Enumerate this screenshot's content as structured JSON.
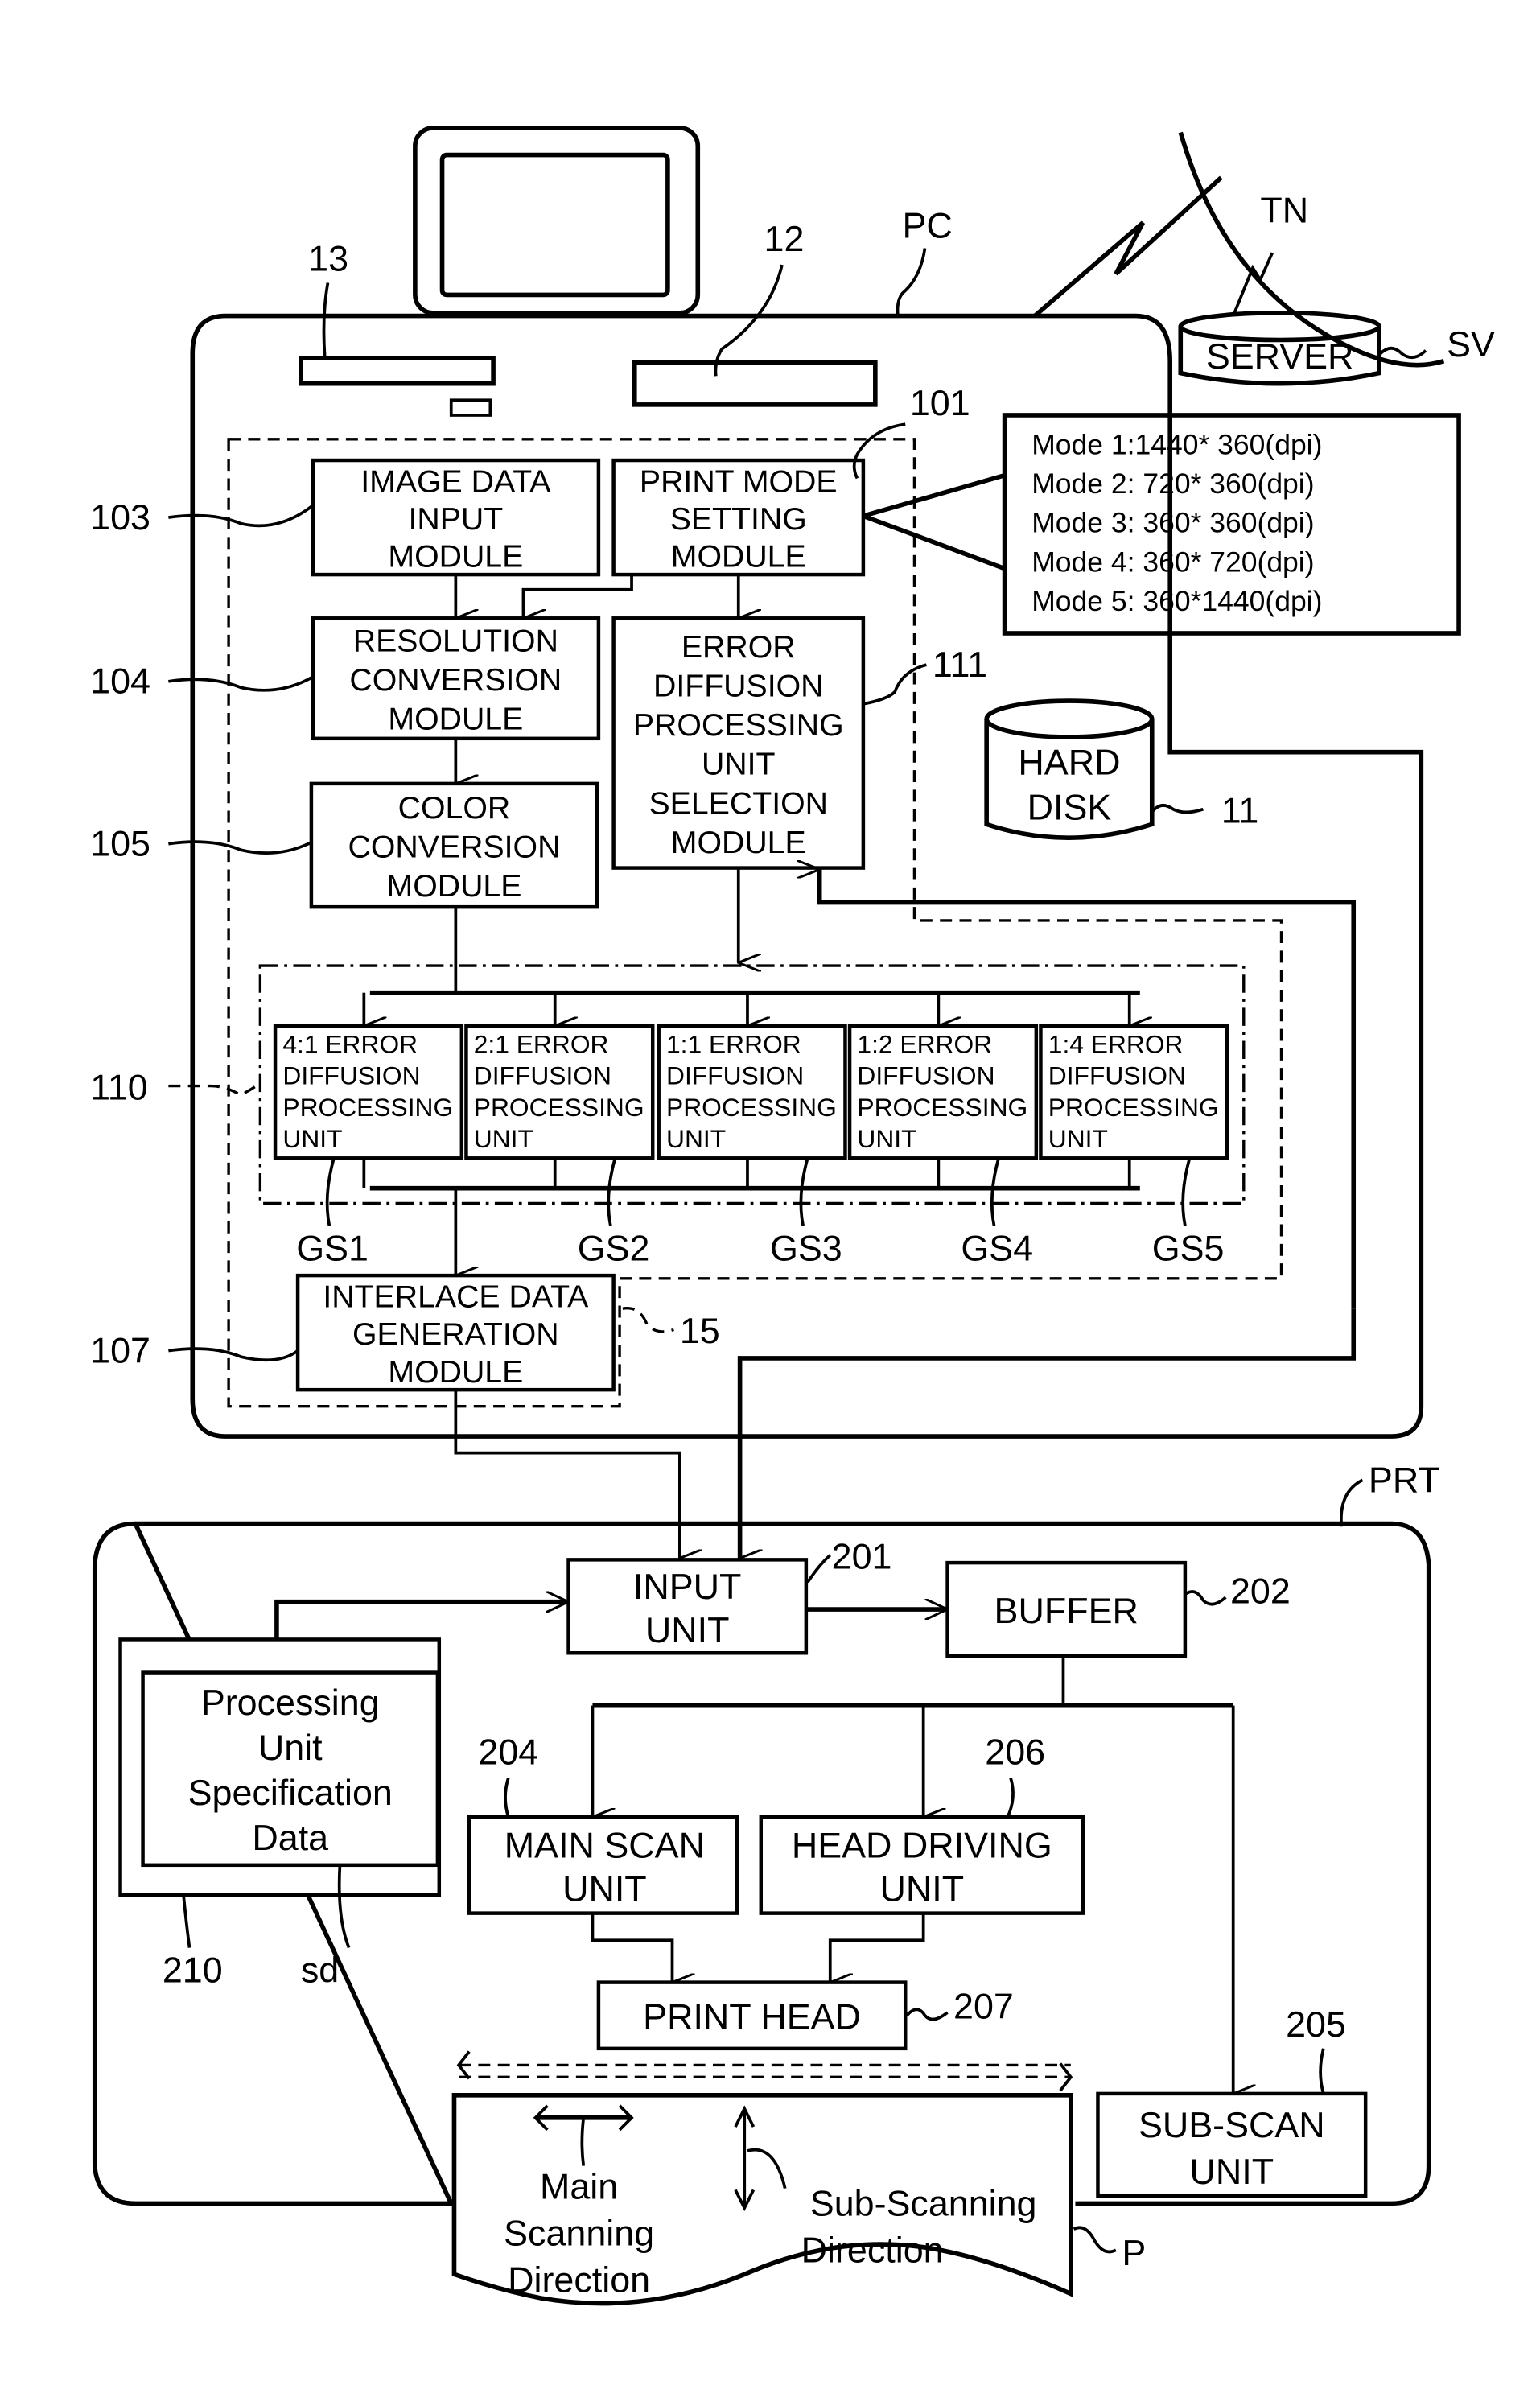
{
  "labels": {
    "pc": "PC",
    "tn": "TN",
    "sv": "SV",
    "ref_13": "13",
    "ref_12": "12",
    "ref_101": "101",
    "ref_103": "103",
    "ref_104": "104",
    "ref_105": "105",
    "ref_111": "111",
    "ref_11": "11",
    "ref_110": "110",
    "ref_107": "107",
    "ref_15": "15",
    "prt": "PRT",
    "ref_201": "201",
    "ref_202": "202",
    "ref_204": "204",
    "ref_206": "206",
    "ref_207": "207",
    "ref_205": "205",
    "ref_210": "210",
    "sd": "sd",
    "p": "P",
    "gs": [
      "GS1",
      "GS2",
      "GS3",
      "GS4",
      "GS5"
    ]
  },
  "server": "SERVER",
  "hard_disk": [
    "HARD",
    "DISK"
  ],
  "modules": {
    "image_data_input": [
      "IMAGE DATA",
      "INPUT",
      "MODULE"
    ],
    "print_mode_setting": [
      "PRINT MODE",
      "SETTING",
      "MODULE"
    ],
    "resolution_conversion": [
      "RESOLUTION",
      "CONVERSION",
      "MODULE"
    ],
    "color_conversion": [
      "COLOR",
      "CONVERSION",
      "MODULE"
    ],
    "error_diffusion_selection": [
      "ERROR",
      "DIFFUSION",
      "PROCESSING",
      "UNIT",
      "SELECTION",
      "MODULE"
    ],
    "interlace_data_generation": [
      "INTERLACE DATA",
      "GENERATION",
      "MODULE"
    ]
  },
  "print_modes": [
    "Mode 1:1440* 360(dpi)",
    "Mode 2: 720* 360(dpi)",
    "Mode 3: 360* 360(dpi)",
    "Mode 4: 360* 720(dpi)",
    "Mode 5: 360*1440(dpi)"
  ],
  "error_units": [
    [
      "4:1 ERROR",
      "DIFFUSION",
      "PROCESSING",
      "UNIT"
    ],
    [
      "2:1 ERROR",
      "DIFFUSION",
      "PROCESSING",
      "UNIT"
    ],
    [
      "1:1 ERROR",
      "DIFFUSION",
      "PROCESSING",
      "UNIT"
    ],
    [
      "1:2 ERROR",
      "DIFFUSION",
      "PROCESSING",
      "UNIT"
    ],
    [
      "1:4 ERROR",
      "DIFFUSION",
      "PROCESSING",
      "UNIT"
    ]
  ],
  "printer": {
    "input_unit": [
      "INPUT",
      "UNIT"
    ],
    "buffer": "BUFFER",
    "main_scan_unit": [
      "MAIN SCAN",
      "UNIT"
    ],
    "head_driving_unit": [
      "HEAD DRIVING",
      "UNIT"
    ],
    "print_head": "PRINT HEAD",
    "sub_scan_unit": [
      "SUB-SCAN",
      "UNIT"
    ],
    "spec_data": [
      "Processing",
      "Unit",
      "Specification",
      "Data"
    ]
  },
  "paper": {
    "main_dir": [
      "Main",
      "Scanning",
      "Direction"
    ],
    "sub_dir": [
      "Sub-Scanning",
      "Direction"
    ]
  }
}
